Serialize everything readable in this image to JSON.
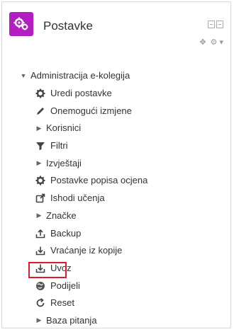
{
  "header": {
    "title": "Postavke",
    "icon": "gears-icon",
    "accent": "#b31ec3"
  },
  "tree": {
    "root_label": "Administracija e-kolegija",
    "items": [
      {
        "label": "Uredi postavke",
        "icon": "gear-icon",
        "expandable": false
      },
      {
        "label": "Onemogući izmjene",
        "icon": "pencil-icon",
        "expandable": false
      },
      {
        "label": "Korisnici",
        "icon": "caret-right-icon",
        "expandable": true
      },
      {
        "label": "Filtri",
        "icon": "filter-icon",
        "expandable": false
      },
      {
        "label": "Izvještaji",
        "icon": "caret-right-icon",
        "expandable": true
      },
      {
        "label": "Postavke popisa ocjena",
        "icon": "gear-icon",
        "expandable": false
      },
      {
        "label": "Ishodi učenja",
        "icon": "external-link-icon",
        "expandable": false
      },
      {
        "label": "Značke",
        "icon": "caret-right-icon",
        "expandable": true
      },
      {
        "label": "Backup",
        "icon": "upload-icon",
        "expandable": false
      },
      {
        "label": "Vraćanje iz kopije",
        "icon": "download-icon",
        "expandable": false
      },
      {
        "label": "Uvoz",
        "icon": "download-icon",
        "expandable": false
      },
      {
        "label": "Podijeli",
        "icon": "globe-icon",
        "expandable": false
      },
      {
        "label": "Reset",
        "icon": "reset-icon",
        "expandable": false
      },
      {
        "label": "Baza pitanja",
        "icon": "caret-right-icon",
        "expandable": true
      }
    ]
  },
  "highlight_color": "#e0192f"
}
